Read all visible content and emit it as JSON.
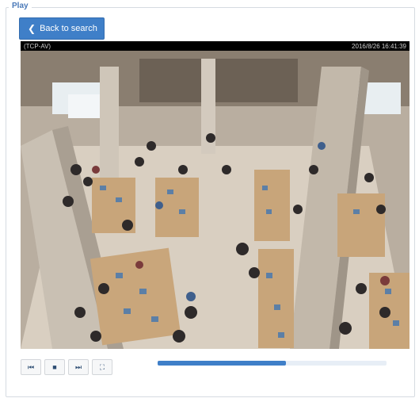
{
  "panel": {
    "legend": "Play"
  },
  "back_button": {
    "label": "Back to search",
    "icon": "chevron-left-icon"
  },
  "video": {
    "overlay_left": "(TCP-AV)",
    "overlay_right": "2016/8/26 16:41:39"
  },
  "controls": {
    "prev": {
      "icon": "skip-previous-icon",
      "glyph": "⏮"
    },
    "stop": {
      "icon": "stop-icon",
      "glyph": "■"
    },
    "next": {
      "icon": "skip-next-icon",
      "glyph": "⏭"
    },
    "fullscreen": {
      "icon": "fullscreen-icon",
      "glyph": "⛶"
    }
  },
  "playback": {
    "progress_fraction": 0.56
  },
  "colors": {
    "accent": "#3f7fc8",
    "legend": "#4a79b8"
  }
}
